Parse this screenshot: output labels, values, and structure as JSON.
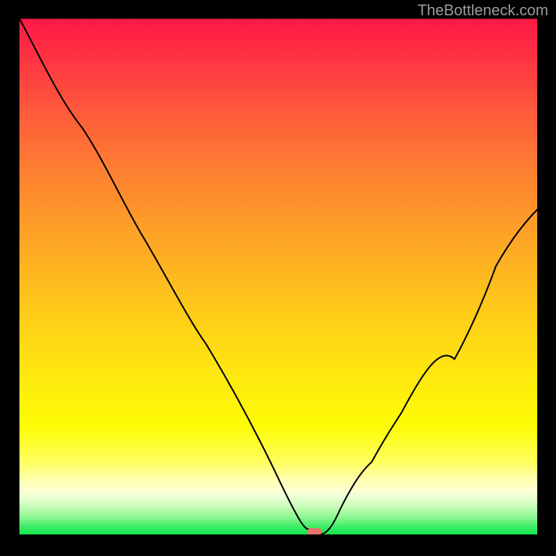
{
  "watermark": "TheBottleneck.com",
  "chart_data": {
    "type": "line",
    "title": "",
    "xlabel": "",
    "ylabel": "",
    "xlim": [
      0,
      100
    ],
    "ylim": [
      0,
      100
    ],
    "grid": false,
    "legend": false,
    "series": [
      {
        "name": "bottleneck-curve",
        "x": [
          0,
          6,
          12,
          18,
          24,
          30,
          36,
          42,
          48,
          51,
          54,
          56,
          58,
          62,
          68,
          74,
          80,
          86,
          92,
          100
        ],
        "values": [
          100,
          90,
          79,
          68,
          57.5,
          47,
          37,
          27,
          15,
          8,
          3,
          1,
          0,
          5,
          14,
          24,
          34,
          43,
          52,
          63
        ]
      }
    ],
    "marker": {
      "x": 56.5,
      "y": 0.8,
      "color": "#e6746a"
    },
    "gradient_stops": [
      {
        "pos": 0.0,
        "color": "#fe1946"
      },
      {
        "pos": 0.18,
        "color": "#fe5a3b"
      },
      {
        "pos": 0.45,
        "color": "#feab24"
      },
      {
        "pos": 0.7,
        "color": "#feea0e"
      },
      {
        "pos": 0.89,
        "color": "#ffffa7"
      },
      {
        "pos": 0.95,
        "color": "#bdfcb1"
      },
      {
        "pos": 1.0,
        "color": "#12e64e"
      }
    ]
  }
}
